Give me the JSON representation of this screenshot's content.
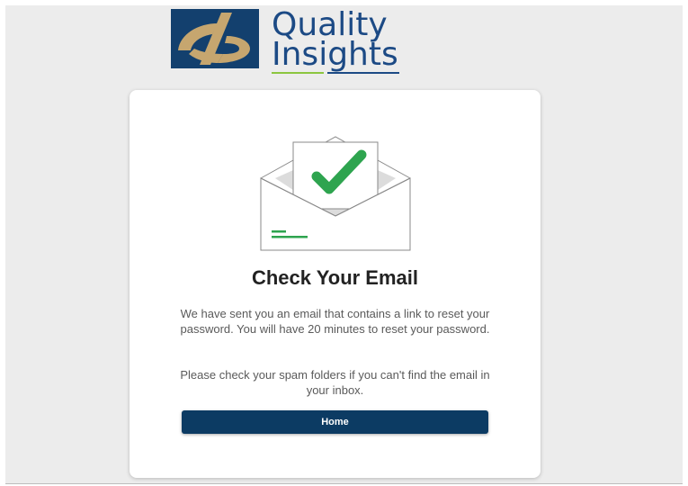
{
  "brand": {
    "line1": "Quality",
    "line2": "Insights",
    "logo_icon": "quality-insights-logo-mark",
    "colors": {
      "navy": "#1c4a85",
      "gold": "#c6a66f",
      "green": "#8cc63f"
    }
  },
  "card": {
    "illustration_icon": "envelope-check-icon",
    "title": "Check Your Email",
    "message_primary": "We have sent you an email that contains a link to reset your password. You will have 20 minutes to reset your password.",
    "message_secondary": "Please check your spam folders if you can't find the email in your inbox.",
    "home_button_label": "Home",
    "colors": {
      "button": "#0c3b63",
      "check": "#2ea44f"
    }
  }
}
